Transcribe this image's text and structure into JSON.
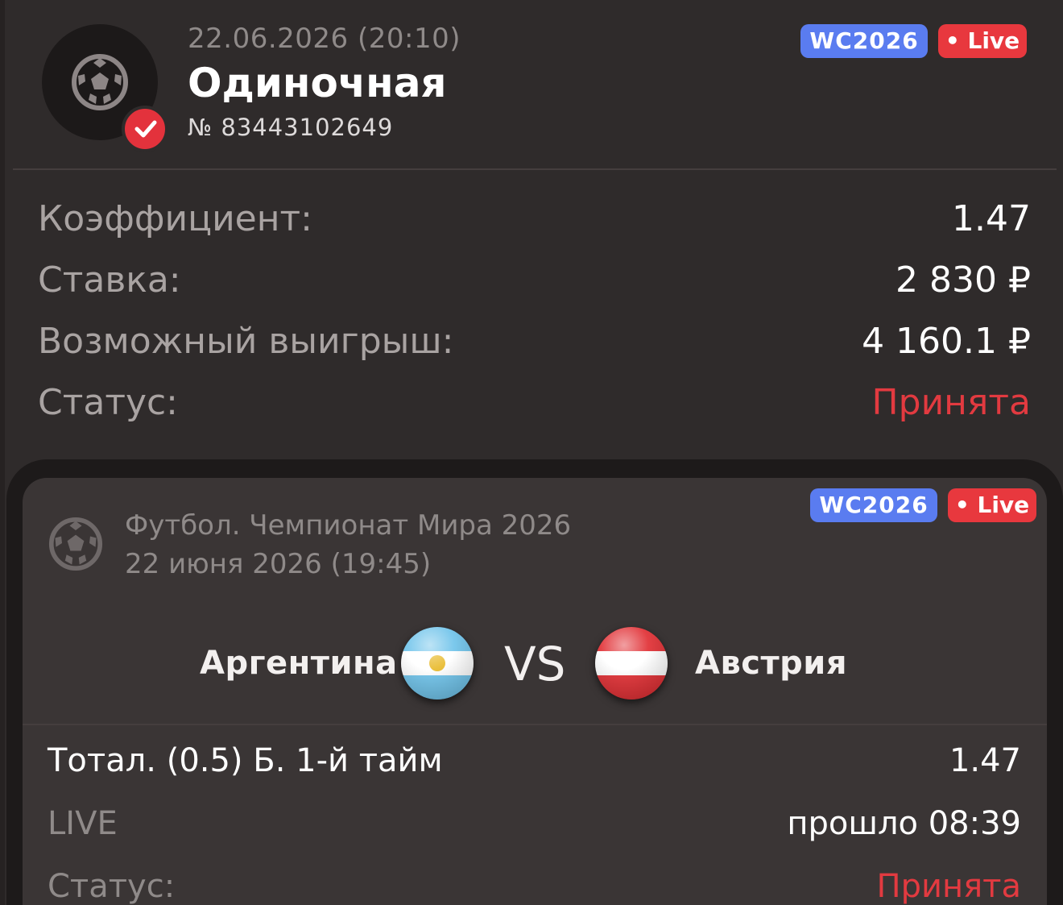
{
  "bet": {
    "datetime": "22.06.2026 (20:10)",
    "type": "Одиночная",
    "number": "№ 83443102649",
    "tags": {
      "tournament": "WC2026",
      "live": "• Live"
    }
  },
  "summary": {
    "odds_label": "Коэффициент:",
    "odds_value": "1.47",
    "stake_label": "Ставка:",
    "stake_value": "2 830 ₽",
    "payout_label": "Возможный выигрыш:",
    "payout_value": "4 160.1 ₽",
    "status_label": "Статус:",
    "status_value": "Принята"
  },
  "event": {
    "league": "Футбол. Чемпионат Мира 2026",
    "date": "22 июня 2026 (19:45)",
    "tags": {
      "tournament": "WC2026",
      "live": "• Live"
    },
    "home_team": "Аргентина",
    "away_team": "Австрия",
    "vs": "VS",
    "market": "Тотал. (0.5) Б. 1-й тайм",
    "market_odds": "1.47",
    "live_label": "LIVE",
    "elapsed": "прошло 08:39",
    "status_label": "Статус:",
    "status_value": "Принята"
  },
  "colors": {
    "background": "#2f2b2b",
    "card": "#3a3535",
    "tournament_tag": "#5a7cf0",
    "live_tag": "#e8383e",
    "accepted": "#e23a40"
  },
  "icons": [
    "football-icon",
    "check-icon",
    "argentina-flag",
    "austria-flag"
  ]
}
